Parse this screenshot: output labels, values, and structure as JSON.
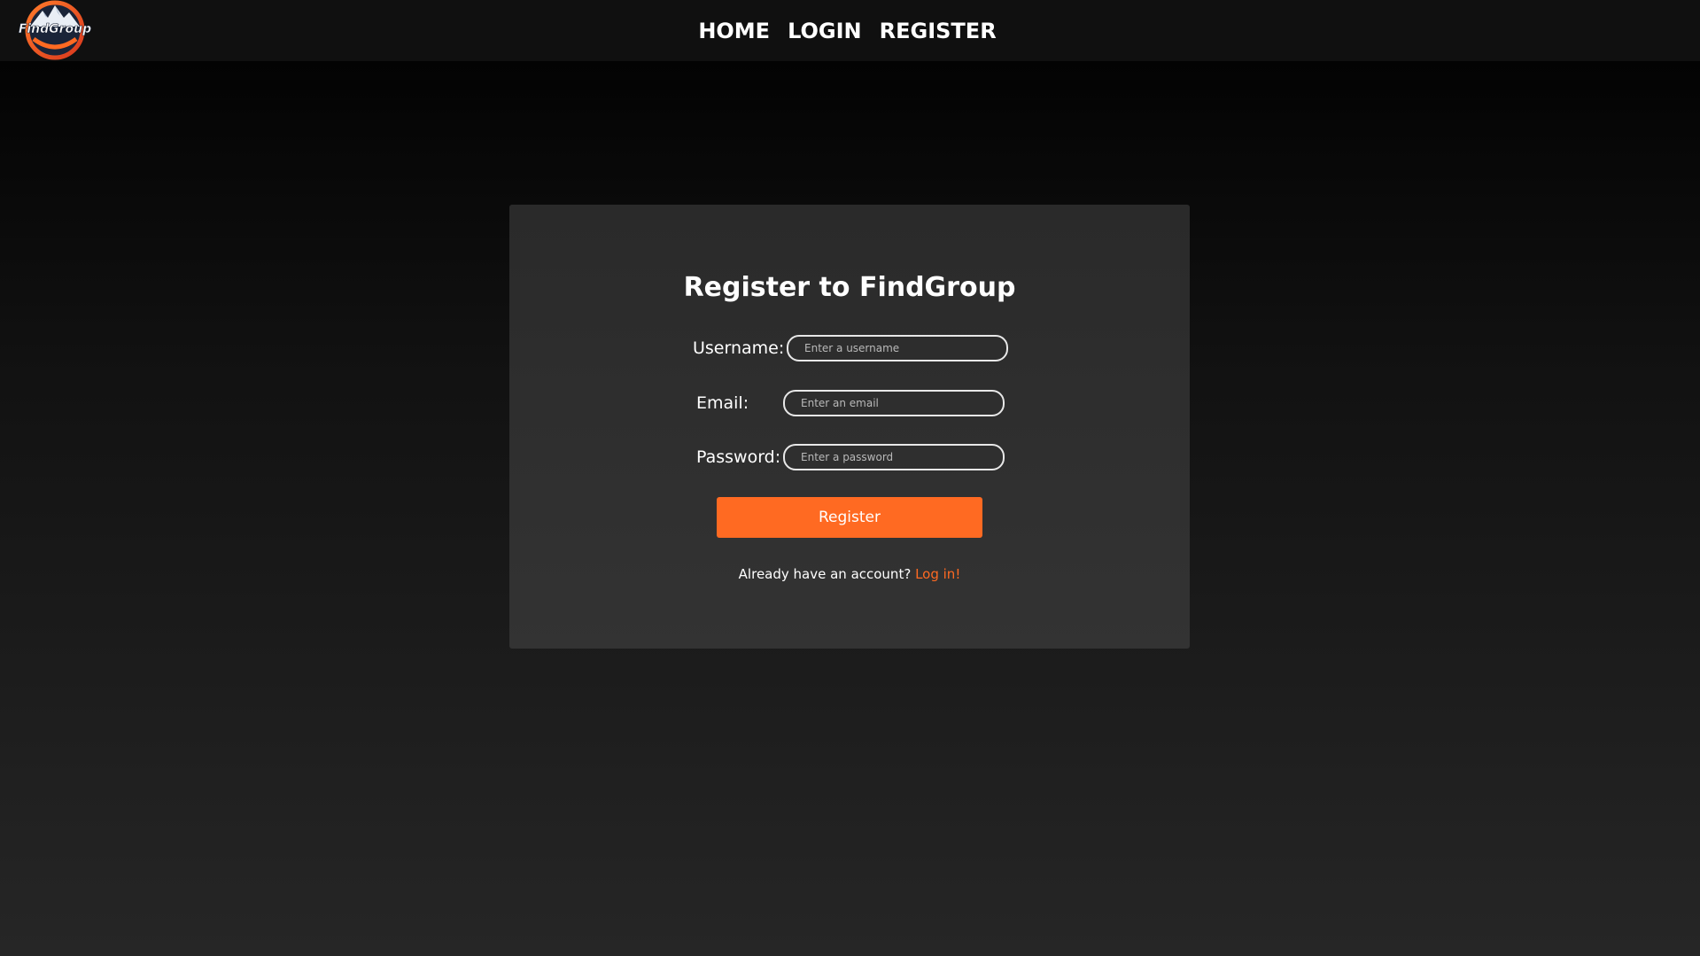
{
  "brand": {
    "logo_text": "FindGroup",
    "accent_color": "#ff6a22"
  },
  "nav": {
    "home_label": "HOME",
    "login_label": "LOGIN",
    "register_label": "REGISTER"
  },
  "form": {
    "title": "Register to FindGroup",
    "username_label": "Username:",
    "username_placeholder": "Enter a username",
    "email_label": "Email:",
    "email_placeholder": "Enter an email",
    "password_label": "Password:",
    "password_placeholder": "Enter a password",
    "submit_label": "Register",
    "signin_prompt": "Already have an account?",
    "signin_link": "Log in!"
  }
}
